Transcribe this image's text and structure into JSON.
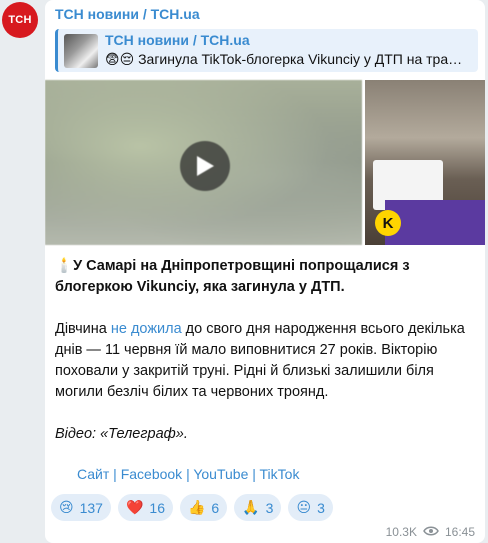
{
  "channel": {
    "avatar_text": "ТСН",
    "name": "ТСН новини / TCH.ua"
  },
  "forwarded": {
    "title": "ТСН новини / TCH.ua",
    "text": "😨😔 Загинула TikTok-блогерка Vikunciy у ДТП на тра…"
  },
  "post": {
    "lead_emoji": "🕯️",
    "lead_bold": "У Самарі на Дніпропетровщині попрощалися з блогеркою Vikunciy, яка загинула у ДТП.",
    "p2_before": "Дівчина ",
    "p2_link": "не дожила",
    "p2_after": " до свого дня народження всього декілька днів — 11 червня їй мало виповнитися 27 років. Вікторію поховали у закритій труні. Рідні й близькі залишили біля могили безліч білих та червоних троянд.",
    "video_credit": "Відео: «Телеграф».",
    "links": "Сайт | Facebook | YouTube | TikTok"
  },
  "media": {
    "side_badge": "K"
  },
  "reactions": [
    {
      "emoji": "😢",
      "count": "137"
    },
    {
      "emoji": "❤️",
      "count": "16"
    },
    {
      "emoji": "👍",
      "count": "6"
    },
    {
      "emoji": "🙏",
      "count": "3"
    },
    {
      "emoji": "😐",
      "count": "3"
    }
  ],
  "meta": {
    "views": "10.3K",
    "time": "16:45"
  }
}
